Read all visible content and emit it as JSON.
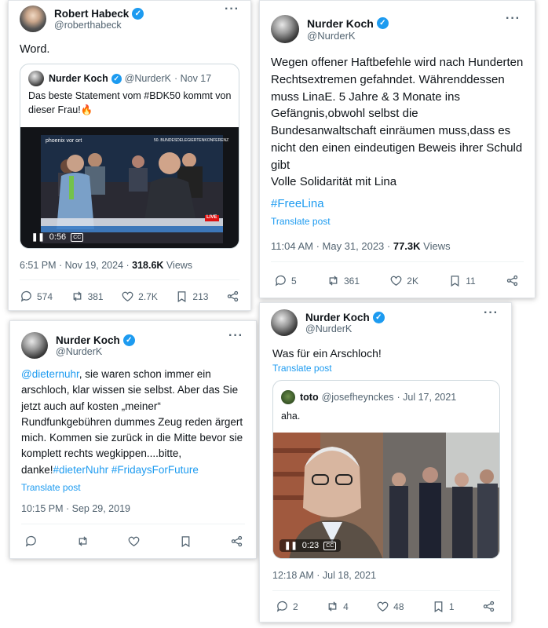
{
  "post1": {
    "author": "Robert Habeck",
    "handle": "@roberthabeck",
    "more": "···",
    "text": "Word.",
    "quote": {
      "author": "Nurder Koch",
      "handle": "@NurderK",
      "date": "· Nov 17",
      "text": "Das beste Statement vom #BDK50 kommt von dieser Frau!🔥",
      "video": {
        "time": "0:56",
        "cc": "CC",
        "channel": "phoenix vor ort",
        "banner": "50. BUNDESDELEGIERTENKONFERENZ",
        "live": "LIVE"
      }
    },
    "time": "6:51 PM · Nov 19, 2024 · ",
    "views_count": "318.6K",
    "views_label": " Views",
    "replies": "574",
    "reposts": "381",
    "likes": "2.7K",
    "bookmarks": "213"
  },
  "post2": {
    "author": "Nurder Koch",
    "handle": "@NurderK",
    "more": "···",
    "text": "Wegen offener Haftbefehle wird nach Hunderten Rechtsextremen gefahndet. Währenddessen muss LinaE. 5 Jahre & 3 Monate ins Gefängnis,obwohl selbst die Bundesanwaltschaft einräumen muss,dass es nicht den einen eindeutigen Beweis ihrer Schuld gibt\nVolle Solidarität mit Lina",
    "hashtag": "#FreeLina",
    "translate": "Translate post",
    "time": "11:04 AM · May 31, 2023 · ",
    "views_count": "77.3K",
    "views_label": " Views",
    "replies": "5",
    "reposts": "361",
    "likes": "2K",
    "bookmarks": "11"
  },
  "post3": {
    "author": "Nurder Koch",
    "handle": "@NurderK",
    "more": "···",
    "mention": "@dieternuhr",
    "text": ", sie waren schon immer ein arschloch, klar wissen sie selbst. Aber das Sie jetzt auch auf kosten „meiner“ Rundfunkgebühren dummes Zeug reden ärgert mich. Kommen sie zurück in die Mitte bevor sie komplett rechts wegkippen....bitte, danke!",
    "hashtag1": "#dieterNuhr",
    "hashtag2": "#FridaysForFuture",
    "translate": "Translate post",
    "time": "10:15 PM · Sep 29, 2019"
  },
  "post4": {
    "author": "Nurder Koch",
    "handle": "@NurderK",
    "more": "···",
    "text": "Was für ein Arschloch!",
    "translate": "Translate post",
    "quote": {
      "author": "toto",
      "handle": "@josefheynckes",
      "date": "· Jul 17, 2021",
      "text": "aha.",
      "video": {
        "time": "0:23",
        "cc": "CC"
      }
    },
    "time": "12:18 AM · Jul 18, 2021",
    "replies": "2",
    "reposts": "4",
    "likes": "48",
    "bookmarks": "1"
  },
  "colors": {
    "accent": "#1d9bf0",
    "muted": "#536471",
    "text": "#0f1419"
  },
  "icons": [
    "reply-icon",
    "repost-icon",
    "like-icon",
    "bookmark-icon",
    "share-icon",
    "verified-icon",
    "more-icon",
    "pause-icon",
    "captions-icon"
  ]
}
